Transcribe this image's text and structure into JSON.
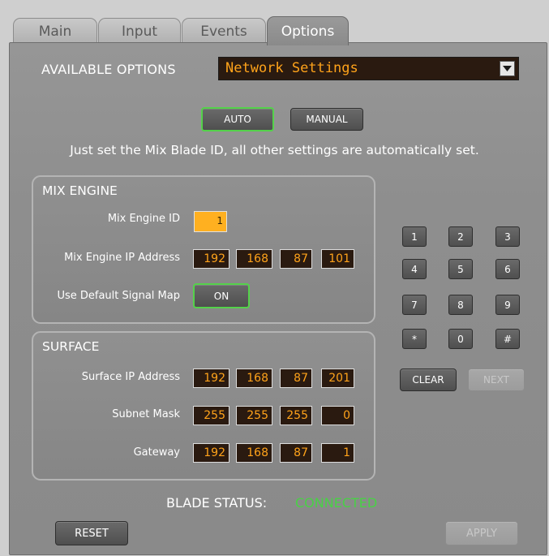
{
  "tabs": [
    {
      "label": "Main"
    },
    {
      "label": "Input"
    },
    {
      "label": "Events"
    },
    {
      "label": "Options",
      "active": true
    }
  ],
  "options": {
    "label": "AVAILABLE OPTIONS",
    "selected": "Network Settings"
  },
  "mode": {
    "auto_label": "AUTO",
    "manual_label": "MANUAL",
    "active": "AUTO",
    "info": "Just set the Mix Blade ID, all other settings are automatically set."
  },
  "mix_engine": {
    "title": "MIX ENGINE",
    "id_label": "Mix Engine ID",
    "id_value": "1",
    "ip_label": "Mix Engine IP Address",
    "ip": [
      "192",
      "168",
      "87",
      "101"
    ],
    "signal_map_label": "Use Default Signal Map",
    "signal_map_value": "ON"
  },
  "surface": {
    "title": "SURFACE",
    "ip_label": "Surface IP Address",
    "ip": [
      "192",
      "168",
      "87",
      "201"
    ],
    "subnet_label": "Subnet Mask",
    "subnet": [
      "255",
      "255",
      "255",
      "0"
    ],
    "gateway_label": "Gateway",
    "gateway": [
      "192",
      "168",
      "87",
      "1"
    ]
  },
  "keypad": {
    "keys": [
      "1",
      "2",
      "3",
      "4",
      "5",
      "6",
      "7",
      "8",
      "9",
      "*",
      "0",
      "#"
    ],
    "clear_label": "CLEAR",
    "next_label": "NEXT"
  },
  "status": {
    "label": "BLADE STATUS:",
    "value": "CONNECTED"
  },
  "footer": {
    "reset_label": "RESET",
    "apply_label": "APPLY"
  },
  "colors": {
    "field_text": "#ffa31a",
    "field_bg": "#2a1a10",
    "active_border": "#54d24a",
    "status_connected": "#49d146",
    "id_field_bg": "#ffb020"
  }
}
